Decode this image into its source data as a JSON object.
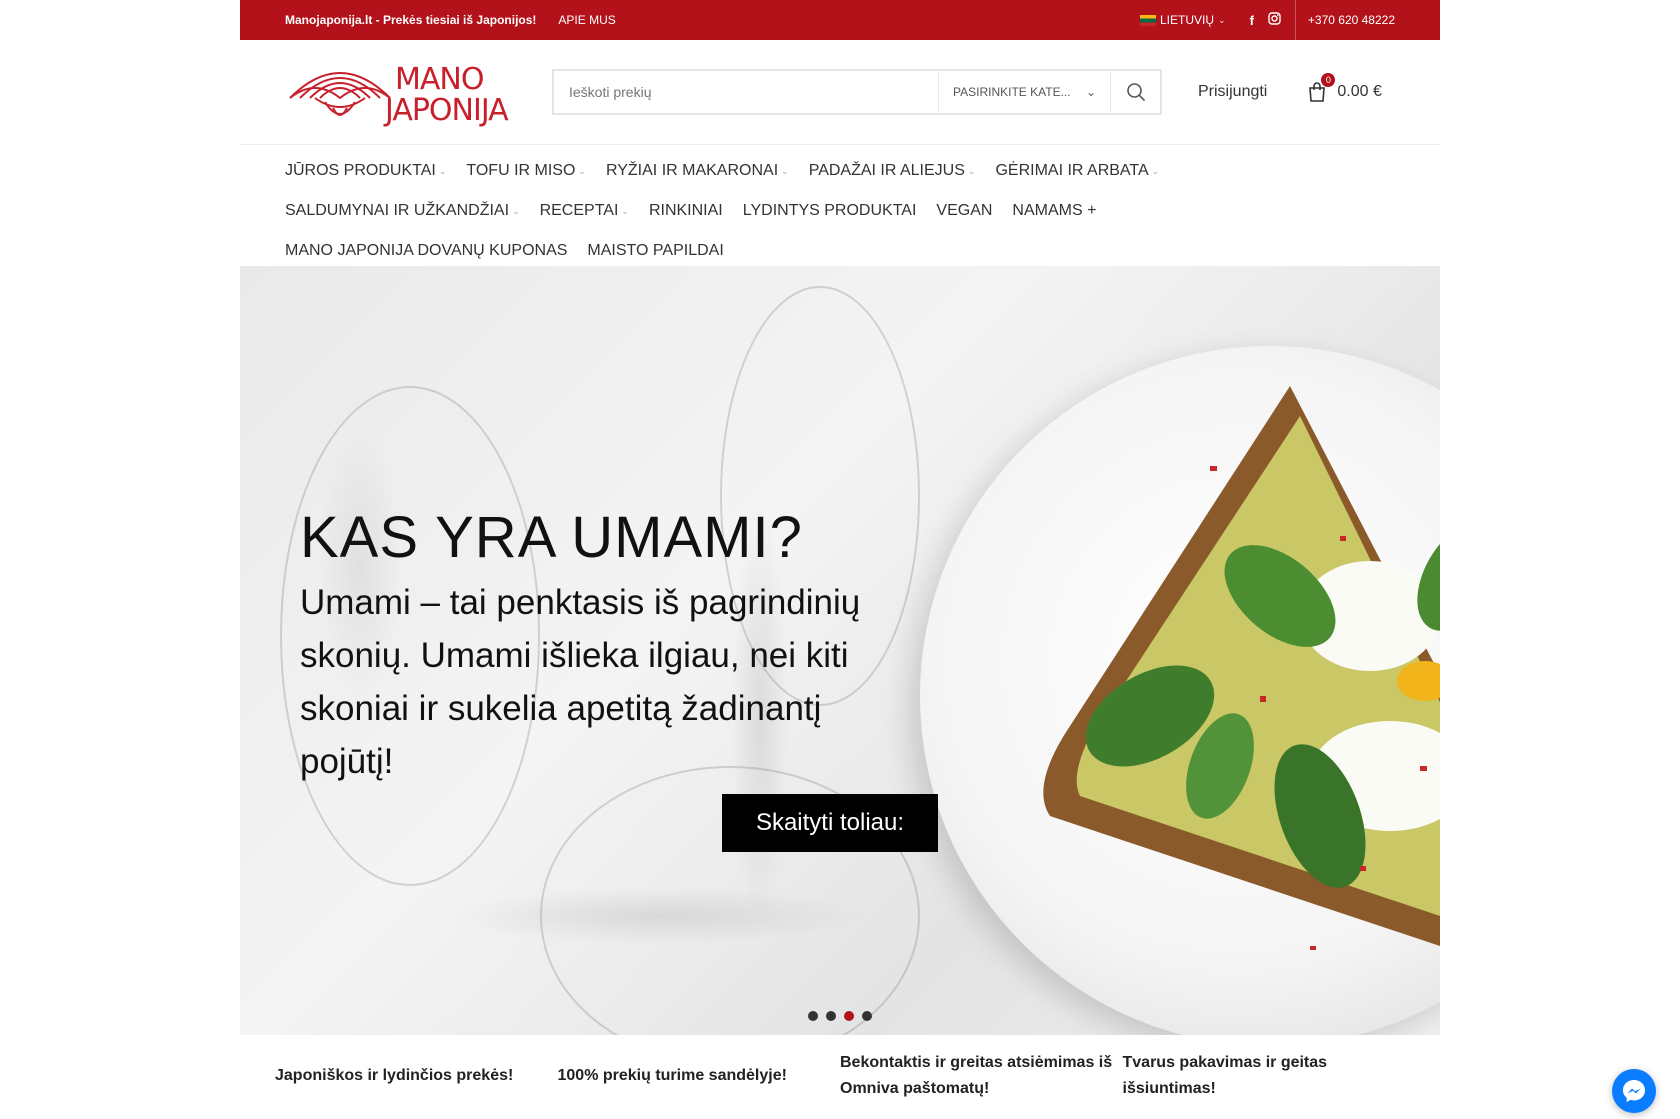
{
  "topbar": {
    "tagline": "Manojaponija.lt - Prekės tiesiai iš Japonijos!",
    "about": "APIE MUS",
    "language": "LIETUVIŲ",
    "phone": "+370 620 48222"
  },
  "header": {
    "logo_line1": "MANO",
    "logo_line2": "JAPONIJA",
    "search_placeholder": "Ieškoti prekių",
    "category_select": "PASIRINKITE KATE...",
    "login": "Prisijungti",
    "cart_count": "0",
    "cart_total": "0.00 €"
  },
  "nav": {
    "row1": [
      {
        "label": "JŪROS PRODUKTAI",
        "dropdown": true
      },
      {
        "label": "TOFU IR MISO",
        "dropdown": true
      },
      {
        "label": "RYŽIAI IR MAKARONAI",
        "dropdown": true
      },
      {
        "label": "PADAŽAI IR ALIEJUS",
        "dropdown": true
      },
      {
        "label": "GĖRIMAI IR ARBATA",
        "dropdown": true
      }
    ],
    "row2": [
      {
        "label": "SALDUMYNAI IR UŽKANDŽIAI",
        "dropdown": true
      },
      {
        "label": "RECEPTAI",
        "dropdown": true
      },
      {
        "label": "RINKINIAI",
        "dropdown": false
      },
      {
        "label": "LYDINTYS PRODUKTAI",
        "dropdown": false
      },
      {
        "label": "VEGAN",
        "dropdown": false
      },
      {
        "label": "NAMAMS +",
        "dropdown": false
      }
    ],
    "row3": [
      {
        "label": "MANO JAPONIJA DOVANŲ KUPONAS",
        "dropdown": false
      },
      {
        "label": "MAISTO PAPILDAI",
        "dropdown": false
      }
    ]
  },
  "hero": {
    "title": "KAS YRA UMAMI?",
    "text": "Umami – tai penktasis iš pagrindinių skonių. Umami išlieka ilgiau, nei kiti skoniai ir sukelia apetitą žadinantį pojūtį!",
    "button": "Skaityti toliau:",
    "slide_count": 4,
    "active_slide": 3
  },
  "features": [
    "Japoniškos ir lydinčios prekės!",
    "100% prekių turime sandėlyje!",
    "Bekontaktis ir greitas atsiėmimas iš Omniva paštomatų!",
    "Tvarus pakavimas ir geitas išsiuntimas!"
  ],
  "colors": {
    "brand_red": "#b3121b",
    "messenger_blue": "#0a7cff"
  }
}
